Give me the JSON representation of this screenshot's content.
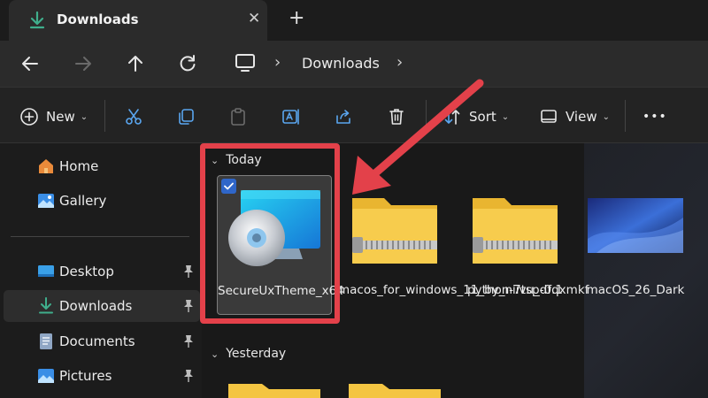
{
  "tab": {
    "title": "Downloads",
    "close": "✕",
    "new_tab": "+"
  },
  "address": {
    "location": "Downloads",
    "separator": "›"
  },
  "toolbar": {
    "new_label": "New",
    "sort_label": "Sort",
    "view_label": "View",
    "more": "•••",
    "chevron": "⌄"
  },
  "sidebar": {
    "items": [
      {
        "label": "Home",
        "icon": "home-icon"
      },
      {
        "label": "Gallery",
        "icon": "gallery-icon"
      },
      {
        "label": "Desktop",
        "icon": "desktop-icon",
        "pinned": true
      },
      {
        "label": "Downloads",
        "icon": "download-icon",
        "pinned": true,
        "active": true
      },
      {
        "label": "Documents",
        "icon": "documents-icon",
        "pinned": true
      },
      {
        "label": "Pictures",
        "icon": "pictures-icon",
        "pinned": true
      }
    ]
  },
  "groups": {
    "today": "Today",
    "yesterday": "Yesterday",
    "chevron": "⌄"
  },
  "files": [
    {
      "name": "SecureUxTheme_x64",
      "type": "installer",
      "selected": true
    },
    {
      "name": "macos_for_windows_11_by_niivu_dfqxmkf",
      "type": "zip-folder"
    },
    {
      "name": "python-7tsp-0.1",
      "type": "zip-folder"
    },
    {
      "name": "macOS_26_Dark",
      "type": "image"
    }
  ],
  "colors": {
    "accent": "#2f66c9",
    "annotation": "#e3414a",
    "folder": "#f4c542",
    "download_green": "#3fae8c"
  }
}
